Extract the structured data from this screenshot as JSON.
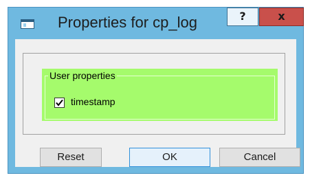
{
  "window": {
    "title": "Properties for cp_log",
    "help_label": "?",
    "close_label": "x"
  },
  "group": {
    "legend": "User properties",
    "options": [
      {
        "label": "timestamp",
        "checked": true
      }
    ]
  },
  "buttons": {
    "reset": "Reset",
    "ok": "OK",
    "cancel": "Cancel"
  },
  "colors": {
    "titlebar": "#6fb9e0",
    "group_background": "#a5fb6c",
    "close_button": "#c9504b",
    "client_background": "#f0f0f0"
  }
}
